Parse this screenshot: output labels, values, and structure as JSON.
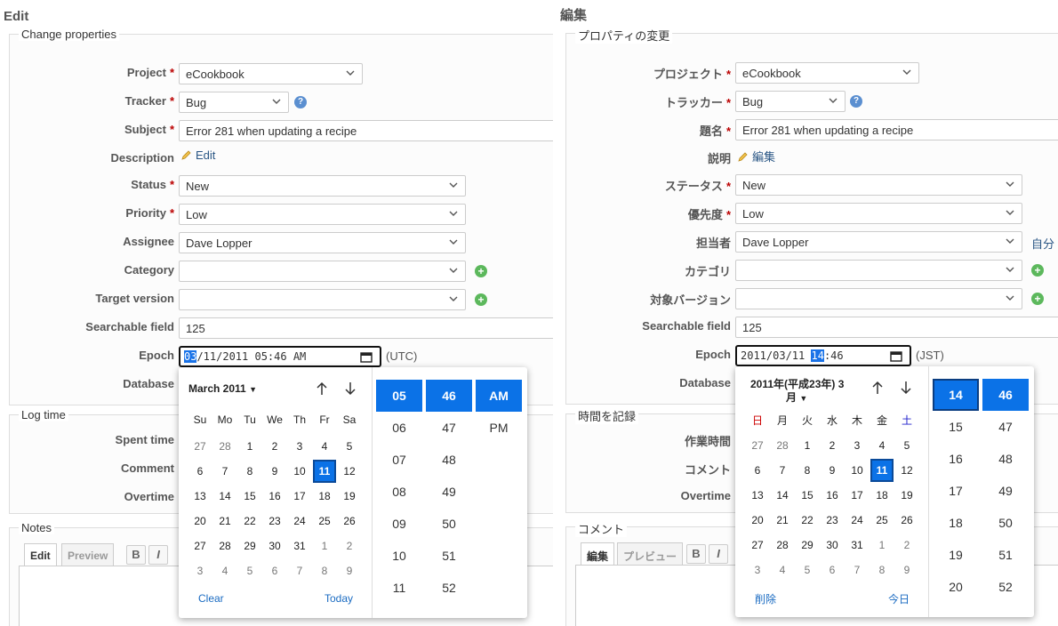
{
  "en": {
    "title": "Edit",
    "props_legend": "Change properties",
    "labels": {
      "project": "Project",
      "tracker": "Tracker",
      "subject": "Subject",
      "description": "Description",
      "status": "Status",
      "priority": "Priority",
      "assignee": "Assignee",
      "category": "Category",
      "target": "Target version",
      "searchable": "Searchable field",
      "epoch": "Epoch",
      "database": "Database"
    },
    "values": {
      "project": "eCookbook",
      "tracker": "Bug",
      "subject": "Error 281 when updating a recipe",
      "status": "New",
      "priority": "Low",
      "assignee": "Dave Lopper",
      "searchable": "125"
    },
    "edit_link": "Edit",
    "epoch": {
      "seg_sel": "03",
      "rest": "/11/2011 05:46 AM",
      "tz": "(UTC)"
    },
    "log": {
      "legend": "Log time",
      "spent": "Spent time",
      "comment": "Comment",
      "overtime": "Overtime"
    },
    "notes": {
      "legend": "Notes",
      "tab_edit": "Edit",
      "tab_preview": "Preview"
    },
    "picker": {
      "month": "March 2011",
      "dow": [
        "Su",
        "Mo",
        "Tu",
        "We",
        "Th",
        "Fr",
        "Sa"
      ],
      "clear": "Clear",
      "today": "Today",
      "hours": [
        "05",
        "06",
        "07",
        "08",
        "09",
        "10",
        "11"
      ],
      "minutes": [
        "46",
        "47",
        "48",
        "49",
        "50",
        "51",
        "52"
      ],
      "ampm": [
        "AM",
        "PM"
      ]
    }
  },
  "ja": {
    "title": "編集",
    "props_legend": "プロパティの変更",
    "labels": {
      "project": "プロジェクト",
      "tracker": "トラッカー",
      "subject": "題名",
      "description": "説明",
      "status": "ステータス",
      "priority": "優先度",
      "assignee": "担当者",
      "category": "カテゴリ",
      "target": "対象バージョン",
      "searchable": "Searchable field",
      "epoch": "Epoch",
      "database": "Database"
    },
    "values": {
      "project": "eCookbook",
      "tracker": "Bug",
      "subject": "Error 281 when updating a recipe",
      "status": "New",
      "priority": "Low",
      "assignee": "Dave Lopper",
      "searchable": "125"
    },
    "edit_link": "編集",
    "assign_me": "自分",
    "epoch": {
      "pre": "2011/03/11 ",
      "seg_sel": "14",
      "rest": ":46",
      "tz": "(JST)"
    },
    "log": {
      "legend": "時間を記録",
      "spent": "作業時間",
      "comment": "コメント",
      "overtime": "Overtime"
    },
    "notes": {
      "legend": "コメント",
      "tab_edit": "編集",
      "tab_preview": "プレビュー"
    },
    "picker": {
      "month": "2011年(平成23年) 3",
      "month2": "月",
      "dow": [
        "日",
        "月",
        "火",
        "水",
        "木",
        "金",
        "土"
      ],
      "clear": "削除",
      "today": "今日",
      "hours": [
        "14",
        "15",
        "16",
        "17",
        "18",
        "19",
        "20"
      ],
      "minutes": [
        "46",
        "47",
        "48",
        "49",
        "50",
        "51",
        "52"
      ]
    }
  },
  "calendar": {
    "days": [
      27,
      28,
      1,
      2,
      3,
      4,
      5,
      6,
      7,
      8,
      9,
      10,
      11,
      12,
      13,
      14,
      15,
      16,
      17,
      18,
      19,
      20,
      21,
      22,
      23,
      24,
      25,
      26,
      27,
      28,
      29,
      30,
      31,
      1,
      2,
      3,
      4,
      5,
      6,
      7,
      8,
      9
    ],
    "selected_index": 12
  },
  "colors": {
    "accent": "#0b72e7",
    "required": "#bb0000",
    "link": "#2a5685"
  },
  "toolbar": {
    "bold": "B",
    "italic": "I"
  }
}
